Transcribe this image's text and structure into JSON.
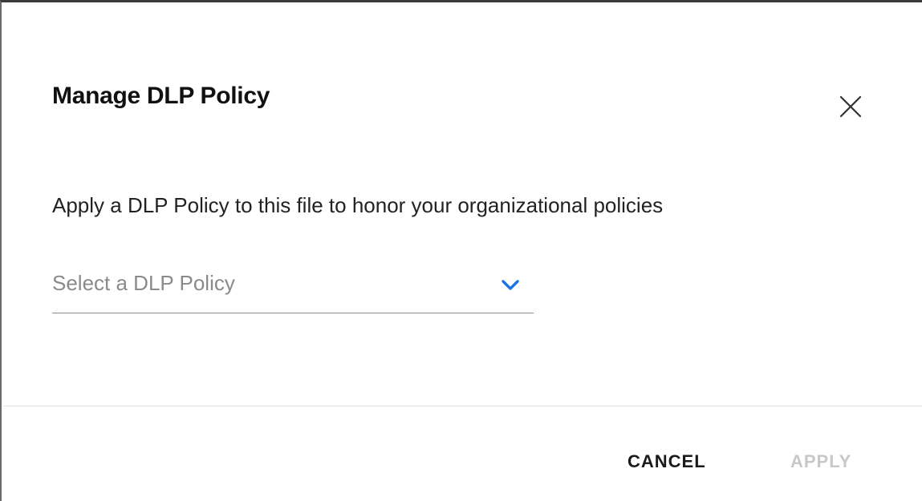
{
  "dialog": {
    "title": "Manage DLP Policy",
    "close_icon": "close-icon",
    "description": "Apply a DLP Policy to this file to honor your organizational policies",
    "policy_select": {
      "placeholder": "Select a DLP Policy",
      "chevron_icon": "chevron-down-icon",
      "chevron_color": "#1a73e8"
    },
    "footer": {
      "cancel_label": "CANCEL",
      "apply_label": "APPLY",
      "apply_enabled": false
    }
  }
}
